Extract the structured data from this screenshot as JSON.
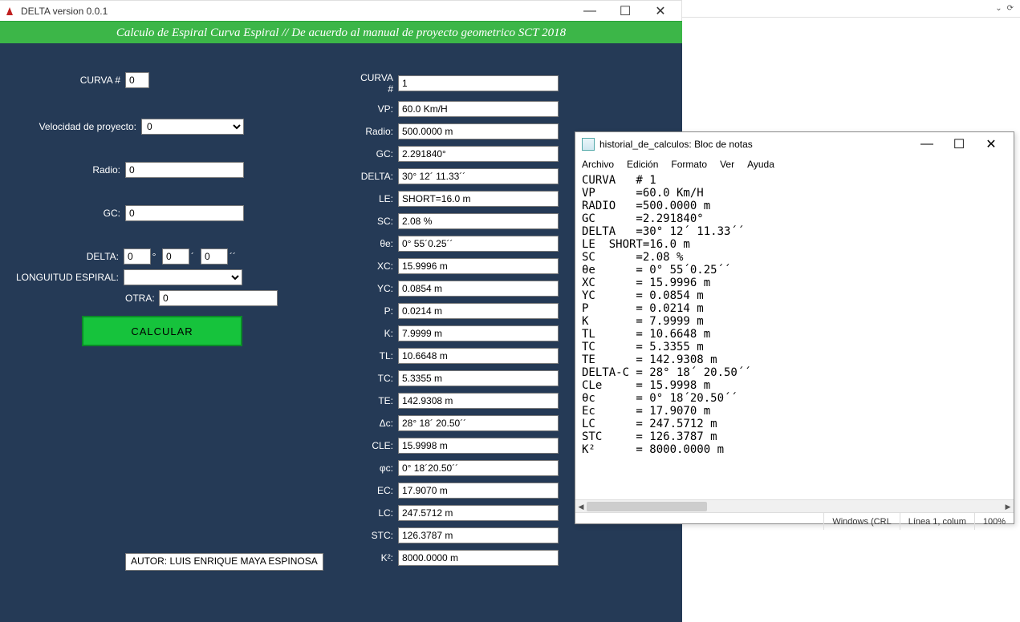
{
  "delta_window": {
    "title": "DELTA version 0.0.1",
    "banner": "Calculo de Espiral Curva Espiral // De acuerdo al manual de proyecto geometrico SCT 2018",
    "left": {
      "curva_label": "CURVA #",
      "curva_val": "0",
      "vp_label": "Velocidad de proyecto:",
      "vp_val": "0",
      "radio_label": "Radio:",
      "radio_val": "0",
      "gc_label": "GC:",
      "gc_val": "0",
      "delta_label": "DELTA:",
      "delta_deg": "0",
      "delta_min": "0",
      "delta_sec": "0",
      "deg_sym": "°",
      "min_sym": "´",
      "sec_sym": "´´",
      "le_label": "LONGUITUD ESPIRAL:",
      "le_val": "",
      "otra_label": "OTRA:",
      "otra_val": "0",
      "calc_button": "CALCULAR",
      "autor": "AUTOR: LUIS ENRIQUE MAYA ESPINOSA"
    },
    "right": {
      "rows": [
        {
          "label": "CURVA #",
          "value": "1"
        },
        {
          "label": "VP:",
          "value": "60.0 Km/H"
        },
        {
          "label": "Radio:",
          "value": "500.0000 m"
        },
        {
          "label": "GC:",
          "value": "2.291840°"
        },
        {
          "label": "DELTA:",
          "value": "30° 12´ 11.33´´"
        },
        {
          "label": "LE:",
          "value": "SHORT=16.0 m"
        },
        {
          "label": "SC:",
          "value": "2.08 %"
        },
        {
          "label": "θe:",
          "value": "0° 55´0.25´´"
        },
        {
          "label": "XC:",
          "value": "15.9996 m"
        },
        {
          "label": "YC:",
          "value": "0.0854 m"
        },
        {
          "label": "P:",
          "value": "0.0214 m"
        },
        {
          "label": "K:",
          "value": "7.9999 m"
        },
        {
          "label": "TL:",
          "value": "10.6648 m"
        },
        {
          "label": "TC:",
          "value": "5.3355 m"
        },
        {
          "label": "TE:",
          "value": "142.9308 m"
        },
        {
          "label": "Δc:",
          "value": "28° 18´ 20.50´´"
        },
        {
          "label": "CLE:",
          "value": "15.9998 m"
        },
        {
          "label": "φc:",
          "value": "0° 18´20.50´´"
        },
        {
          "label": "EC:",
          "value": "17.9070 m"
        },
        {
          "label": "LC:",
          "value": "247.5712 m"
        },
        {
          "label": "STC:",
          "value": "126.3787 m"
        },
        {
          "label": "K²:",
          "value": "8000.0000 m"
        }
      ]
    }
  },
  "notepad": {
    "title": "historial_de_calculos: Bloc de notas",
    "menu": [
      "Archivo",
      "Edición",
      "Formato",
      "Ver",
      "Ayuda"
    ],
    "content": "CURVA   # 1\nVP      =60.0 Km/H\nRADIO   =500.0000 m\nGC      =2.291840°\nDELTA   =30° 12´ 11.33´´\nLE  SHORT=16.0 m\nSC      =2.08 %\nθe      = 0° 55´0.25´´\nXC      = 15.9996 m\nYC      = 0.0854 m\nP       = 0.0214 m\nK       = 7.9999 m\nTL      = 10.6648 m\nTC      = 5.3355 m\nTE      = 142.9308 m\nDELTA-C = 28° 18´ 20.50´´\nCLe     = 15.9998 m\nθc      = 0° 18´20.50´´\nEc      = 17.9070 m\nLC      = 247.5712 m\nSTC     = 126.3787 m\nK²      = 8000.0000 m",
    "status": {
      "enc": "Windows (CRL",
      "pos": "Línea 1, colum",
      "zoom": "100%"
    }
  }
}
